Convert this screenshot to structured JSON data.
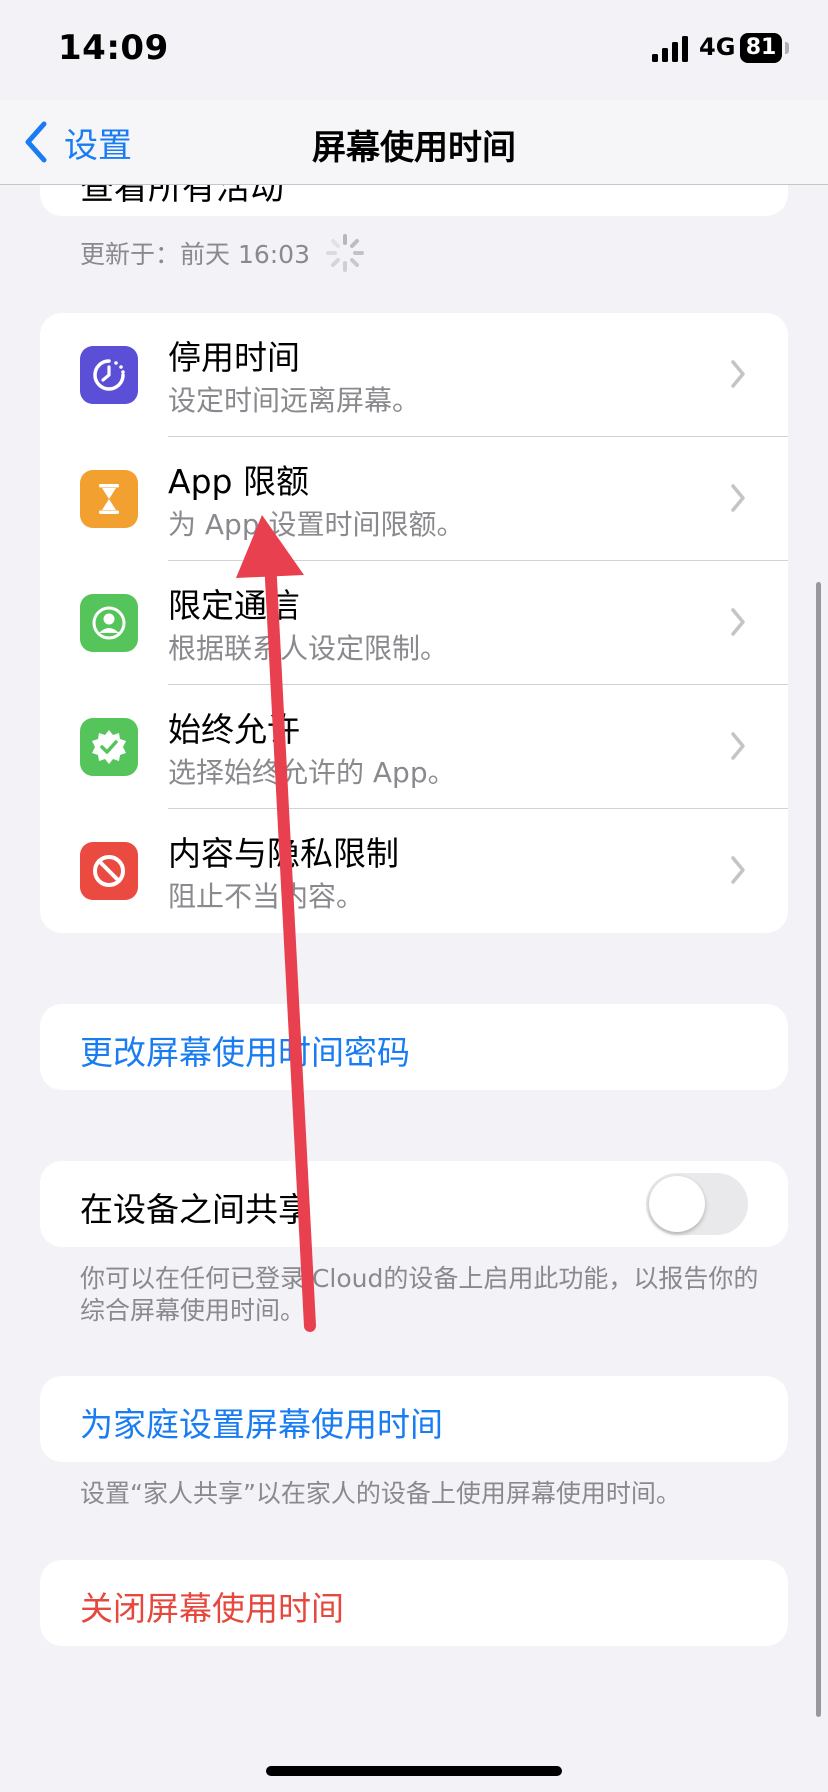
{
  "status_bar": {
    "time": "14:09",
    "network": "4G",
    "battery": "81"
  },
  "nav": {
    "back_label": "设置",
    "title": "屏幕使用时间"
  },
  "top": {
    "partial_label": "查看所有活动",
    "updated": "更新于：前天 16:03"
  },
  "menu": [
    {
      "title": "停用时间",
      "subtitle": "设定时间远离屏幕。",
      "icon": "downtime-icon",
      "color": "#5b4fd8"
    },
    {
      "title": "App 限额",
      "subtitle": "为 App 设置时间限额。",
      "icon": "hourglass-icon",
      "color": "#f2a02f"
    },
    {
      "title": "限定通信",
      "subtitle": "根据联系人设定限制。",
      "icon": "contact-icon",
      "color": "#55c55b"
    },
    {
      "title": "始终允许",
      "subtitle": "选择始终允许的 App。",
      "icon": "checkmark-badge-icon",
      "color": "#55c55b"
    },
    {
      "title": "内容与隐私限制",
      "subtitle": "阻止不当内容。",
      "icon": "prohibited-icon",
      "color": "#ea4a3f"
    }
  ],
  "passcode": {
    "label": "更改屏幕使用时间密码"
  },
  "share": {
    "label": "在设备之间共享",
    "enabled": false,
    "footnote": "你可以在任何已登录iCloud的设备上启用此功能，以报告你的综合屏幕使用时间。"
  },
  "family": {
    "label": "为家庭设置屏幕使用时间",
    "footnote": "设置“家人共享”以在家人的设备上使用屏幕使用时间。"
  },
  "turn_off": {
    "label": "关闭屏幕使用时间"
  },
  "colors": {
    "accent_blue": "#1a7cf2",
    "destructive_red": "#e5483d",
    "annotation_arrow": "#e8404f"
  }
}
